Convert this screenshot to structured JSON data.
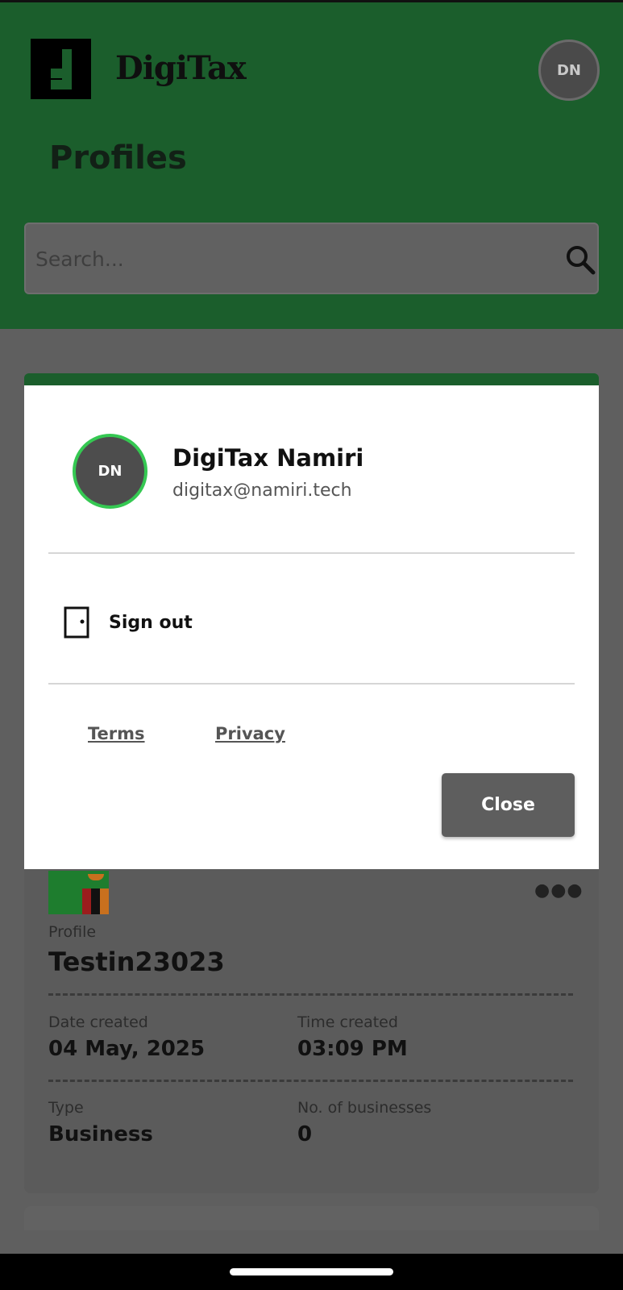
{
  "header": {
    "brand": "DigiTax",
    "avatar_initials": "DN",
    "page_title": "Profiles"
  },
  "search": {
    "placeholder": "Search...",
    "value": ""
  },
  "profile_card": {
    "flag": "zambia-flag",
    "profile_label": "Profile",
    "profile_name": "Testin23023",
    "date_label": "Date created",
    "date_value": "04 May, 2025",
    "time_label": "Time created",
    "time_value": "03:09 PM",
    "type_label": "Type",
    "type_value": "Business",
    "businesses_label": "No. of businesses",
    "businesses_value": "0",
    "more_icon": "more-horizontal-icon"
  },
  "account_modal": {
    "avatar_initials": "DN",
    "name": "DigiTax Namiri",
    "email": "digitax@namiri.tech",
    "sign_out_label": "Sign out",
    "terms_label": "Terms",
    "privacy_label": "Privacy",
    "close_label": "Close"
  },
  "colors": {
    "header_green": "#1b5e2c",
    "avatar_ring": "#35c852",
    "overlay": "#5f5f5f"
  }
}
